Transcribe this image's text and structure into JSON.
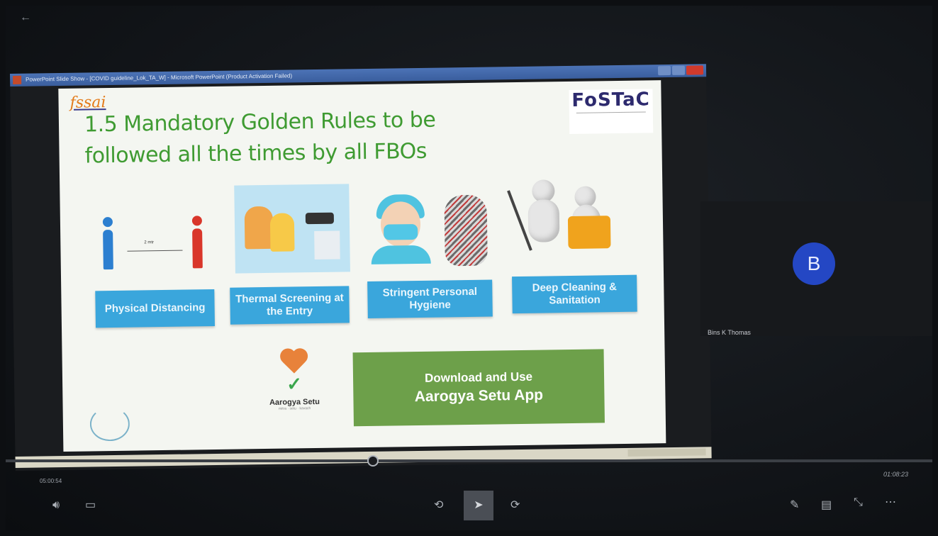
{
  "window": {
    "title": "PowerPoint Slide Show - [COVID guideline_Lok_TA_W] - Microsoft PowerPoint (Product Activation Failed)"
  },
  "slide": {
    "logo_text": "fssai",
    "title_line1": "1.5 Mandatory Golden Rules to be",
    "title_line2": "followed all the times by all FBOs",
    "fostac_brand": "FoSTaC",
    "rules": [
      {
        "label": "Physical Distancing",
        "icon": "social-distancing-icon"
      },
      {
        "label": "Thermal Screening at the Entry",
        "icon": "thermal-screening-icon"
      },
      {
        "label": "Stringent Personal Hygiene",
        "icon": "hygiene-icon"
      },
      {
        "label": "Deep Cleaning & Sanitation",
        "icon": "cleaning-icon"
      }
    ],
    "distance_text": "2 mtr",
    "aarogya_name": "Aarogya Setu",
    "aarogya_tag": "mitra · setu · kavach",
    "download_line1": "Download and Use",
    "download_line2": "Aarogya Setu App"
  },
  "participant": {
    "initial": "B",
    "name": "Bins K Thomas",
    "avatar_color": "#2447c4"
  },
  "player": {
    "time_elapsed": "05:00:54",
    "time_total": "01:08:23",
    "icons": [
      "volume-icon",
      "captions-icon",
      "rewind-icon",
      "pointer-icon",
      "forward-icon",
      "pen-icon",
      "subtitles-icon",
      "exit-fullscreen-icon",
      "more-icon"
    ]
  }
}
